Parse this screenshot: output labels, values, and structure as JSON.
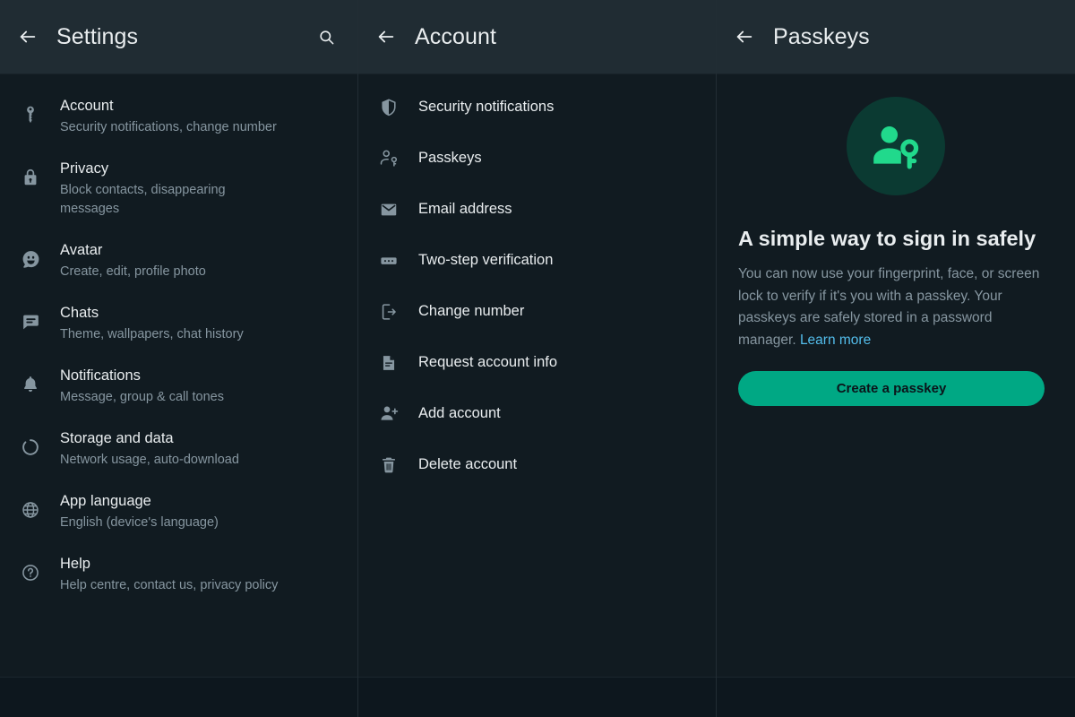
{
  "theme": {
    "header_bg": "#202c33",
    "body_bg": "#111b21",
    "divider": "#222d34",
    "text_primary": "#e9edef",
    "text_secondary": "#8696a0",
    "accent_green": "#00a884",
    "icon_green": "#21d98c",
    "circle_bg": "#0b3a32",
    "link_blue": "#53bdeb"
  },
  "settings_pane": {
    "title": "Settings",
    "back_icon": "arrow-left-icon",
    "search_icon": "search-icon",
    "items": [
      {
        "icon": "key-icon",
        "title": "Account",
        "subtitle": "Security notifications, change number"
      },
      {
        "icon": "lock-icon",
        "title": "Privacy",
        "subtitle": "Block contacts, disappearing messages"
      },
      {
        "icon": "avatar-icon",
        "title": "Avatar",
        "subtitle": "Create, edit, profile photo"
      },
      {
        "icon": "chat-icon",
        "title": "Chats",
        "subtitle": "Theme, wallpapers, chat history"
      },
      {
        "icon": "bell-icon",
        "title": "Notifications",
        "subtitle": "Message, group & call tones"
      },
      {
        "icon": "storage-icon",
        "title": "Storage and data",
        "subtitle": "Network usage, auto-download"
      },
      {
        "icon": "globe-icon",
        "title": "App language",
        "subtitle": "English (device's language)"
      },
      {
        "icon": "help-icon",
        "title": "Help",
        "subtitle": "Help centre, contact us, privacy policy"
      }
    ]
  },
  "account_pane": {
    "title": "Account",
    "back_icon": "arrow-left-icon",
    "items": [
      {
        "icon": "shield-icon",
        "label": "Security notifications"
      },
      {
        "icon": "person-key-icon",
        "label": "Passkeys"
      },
      {
        "icon": "envelope-icon",
        "label": "Email address"
      },
      {
        "icon": "two-step-icon",
        "label": "Two-step verification"
      },
      {
        "icon": "phone-exit-icon",
        "label": "Change number"
      },
      {
        "icon": "document-icon",
        "label": "Request account info"
      },
      {
        "icon": "person-add-icon",
        "label": "Add account"
      },
      {
        "icon": "trash-icon",
        "label": "Delete account"
      }
    ]
  },
  "passkeys_pane": {
    "title": "Passkeys",
    "back_icon": "arrow-left-icon",
    "hero_icon": "person-key-hero-icon",
    "heading": "A simple way to sign in safely",
    "description": "You can now use your fingerprint, face, or screen lock to verify if it's you with a passkey. Your passkeys are safely stored in a password manager. ",
    "link_label": "Learn more",
    "cta_label": "Create a passkey"
  }
}
